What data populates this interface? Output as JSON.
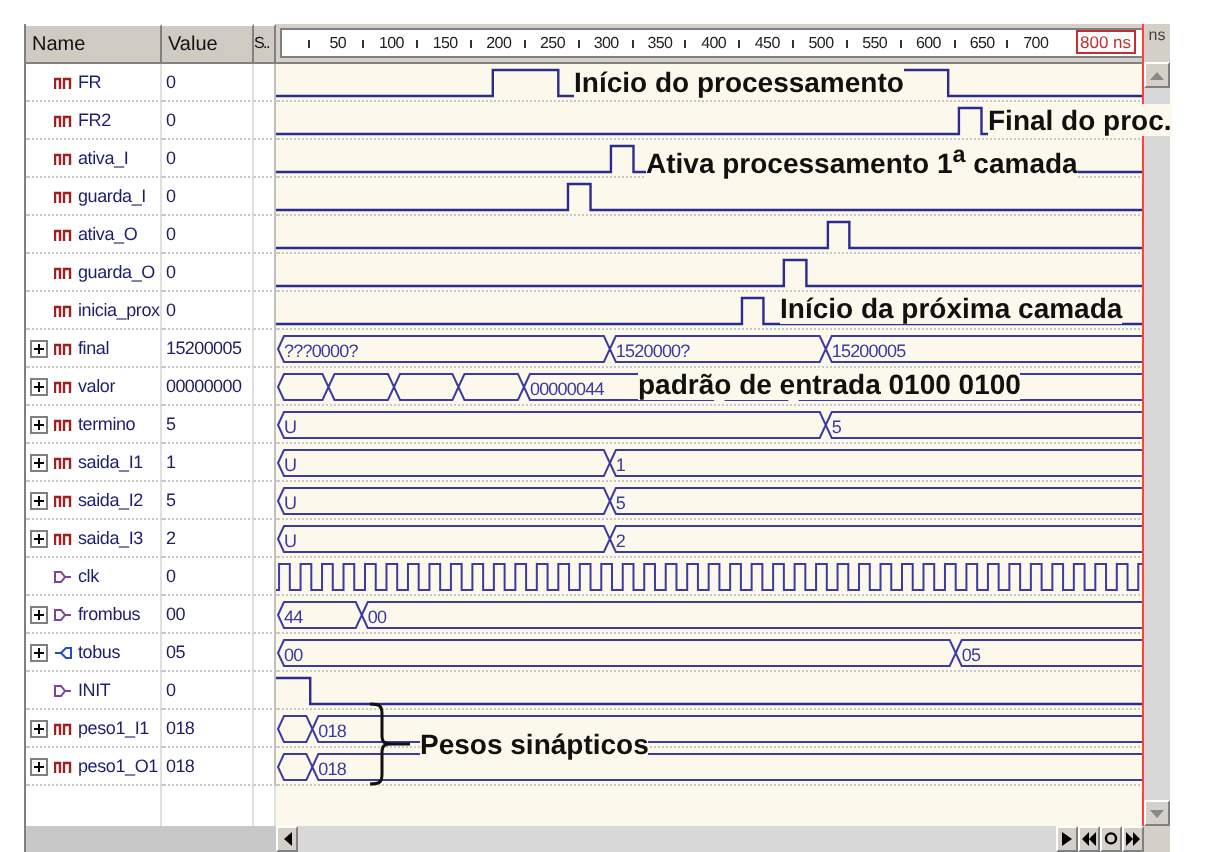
{
  "columns": [
    "Name",
    "Value",
    "S.."
  ],
  "ruler": {
    "labels": [
      "50",
      "100",
      "150",
      "200",
      "250",
      "300",
      "350",
      "400",
      "450",
      "500",
      "550",
      "600",
      "650",
      "700"
    ],
    "cursor": "800 ns",
    "unit": "ns"
  },
  "signals": [
    {
      "name": "FR",
      "value": "0",
      "kind": "wire",
      "expandable": false
    },
    {
      "name": "FR2",
      "value": "0",
      "kind": "wire",
      "expandable": false
    },
    {
      "name": "ativa_I",
      "value": "0",
      "kind": "wire",
      "expandable": false
    },
    {
      "name": "guarda_I",
      "value": "0",
      "kind": "wire",
      "expandable": false
    },
    {
      "name": "ativa_O",
      "value": "0",
      "kind": "wire",
      "expandable": false
    },
    {
      "name": "guarda_O",
      "value": "0",
      "kind": "wire",
      "expandable": false
    },
    {
      "name": "inicia_prox",
      "value": "0",
      "kind": "wire",
      "expandable": false
    },
    {
      "name": "final",
      "value": "15200005",
      "kind": "wire",
      "expandable": true,
      "wave_labels": [
        "???0000?",
        "1520000?",
        "15200005"
      ]
    },
    {
      "name": "valor",
      "value": "00000000",
      "kind": "wire",
      "expandable": true,
      "wave_labels": [
        "00000044"
      ]
    },
    {
      "name": "termino",
      "value": "5",
      "kind": "wire",
      "expandable": true,
      "wave_labels": [
        "U",
        "5"
      ]
    },
    {
      "name": "saida_I1",
      "value": "1",
      "kind": "wire",
      "expandable": true,
      "wave_labels": [
        "U",
        "1"
      ]
    },
    {
      "name": "saida_I2",
      "value": "5",
      "kind": "wire",
      "expandable": true,
      "wave_labels": [
        "U",
        "5"
      ]
    },
    {
      "name": "saida_I3",
      "value": "2",
      "kind": "wire",
      "expandable": true,
      "wave_labels": [
        "U",
        "2"
      ]
    },
    {
      "name": "clk",
      "value": "0",
      "kind": "in",
      "expandable": false
    },
    {
      "name": "frombus",
      "value": "00",
      "kind": "in",
      "expandable": true,
      "wave_labels": [
        "44",
        "00"
      ]
    },
    {
      "name": "tobus",
      "value": "05",
      "kind": "inout",
      "expandable": true,
      "wave_labels": [
        "00",
        "05"
      ]
    },
    {
      "name": "INIT",
      "value": "0",
      "kind": "in",
      "expandable": false
    },
    {
      "name": "peso1_I1",
      "value": "018",
      "kind": "wire",
      "expandable": true,
      "wave_labels": [
        "018"
      ]
    },
    {
      "name": "peso1_O1",
      "value": "018",
      "kind": "wire",
      "expandable": true,
      "wave_labels": [
        "018"
      ]
    }
  ],
  "annotations": [
    "Início do processamento",
    "Final do proc.",
    "Ativa processamento 1$^{a}$ camada",
    "Início da próxima camada",
    "padrão de entrada 0100 0100",
    "Pesos sinápticos"
  ]
}
